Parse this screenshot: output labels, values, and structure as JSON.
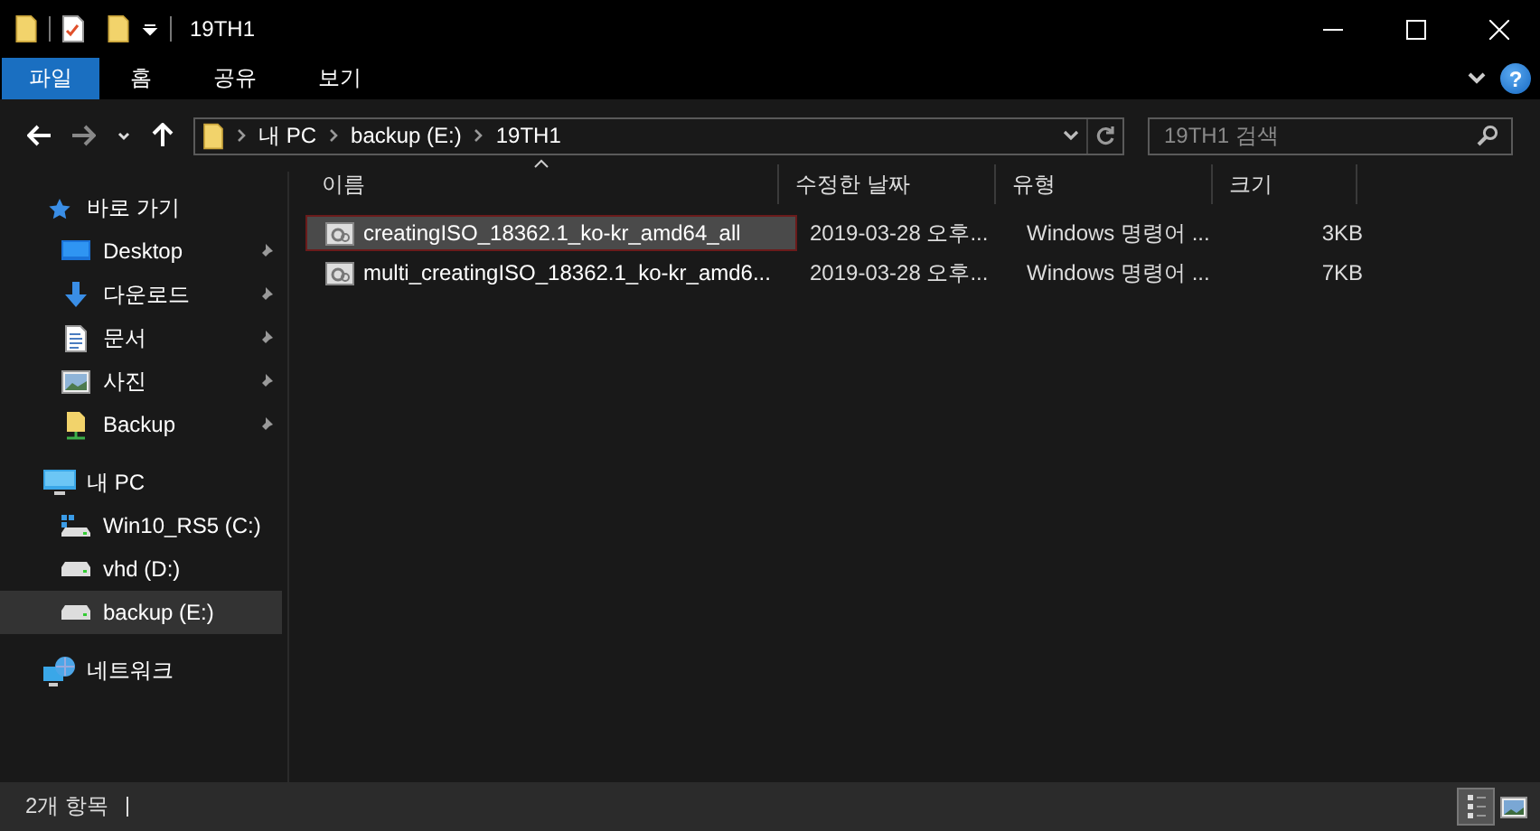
{
  "window": {
    "title": "19TH1"
  },
  "ribbon_tabs": [
    {
      "label": "파일",
      "selected": true
    },
    {
      "label": "홈",
      "selected": false
    },
    {
      "label": "공유",
      "selected": false
    },
    {
      "label": "보기",
      "selected": false
    }
  ],
  "help_button": {
    "label": "?"
  },
  "address": {
    "path": [
      "내 PC",
      "backup (E:)",
      "19TH1"
    ]
  },
  "search": {
    "placeholder": "19TH1 검색"
  },
  "sidebar": {
    "items": [
      {
        "label": "바로 가기",
        "kind": "quick",
        "selected": false,
        "children": [
          {
            "label": "Desktop",
            "kind": "desktop",
            "pinned": true,
            "selected": false
          },
          {
            "label": "다운로드",
            "kind": "download",
            "pinned": true,
            "selected": false
          },
          {
            "label": "문서",
            "kind": "document",
            "pinned": true,
            "selected": false
          },
          {
            "label": "사진",
            "kind": "photo",
            "pinned": true,
            "selected": false
          },
          {
            "label": "Backup",
            "kind": "share",
            "pinned": true,
            "selected": false
          }
        ]
      },
      {
        "label": "내 PC",
        "kind": "pc",
        "selected": false,
        "children": [
          {
            "label": "Win10_RS5 (C:)",
            "kind": "system-drive",
            "pinned": false,
            "selected": false
          },
          {
            "label": "vhd (D:)",
            "kind": "drive",
            "pinned": false,
            "selected": false
          },
          {
            "label": "backup (E:)",
            "kind": "drive",
            "pinned": false,
            "selected": true
          }
        ]
      },
      {
        "label": "네트워크",
        "kind": "network",
        "selected": false
      }
    ]
  },
  "table": {
    "columns": [
      {
        "label": "이름",
        "sorted": true
      },
      {
        "label": "수정한 날짜",
        "sorted": false
      },
      {
        "label": "유형",
        "sorted": false
      },
      {
        "label": "크기",
        "sorted": false
      }
    ],
    "rows": [
      {
        "name": "creatingISO_18362.1_ko-kr_amd64_all",
        "date": "2019-03-28 오후...",
        "type": "Windows 명령어 ...",
        "size": "3KB",
        "selected": true
      },
      {
        "name": "multi_creatingISO_18362.1_ko-kr_amd6...",
        "date": "2019-03-28 오후...",
        "type": "Windows 명령어 ...",
        "size": "7KB",
        "selected": false
      }
    ]
  },
  "status_bar": {
    "count": "2개 항목",
    "view_buttons": [
      {
        "kind": "details",
        "selected": true
      },
      {
        "kind": "large-icons",
        "selected": false
      }
    ]
  }
}
